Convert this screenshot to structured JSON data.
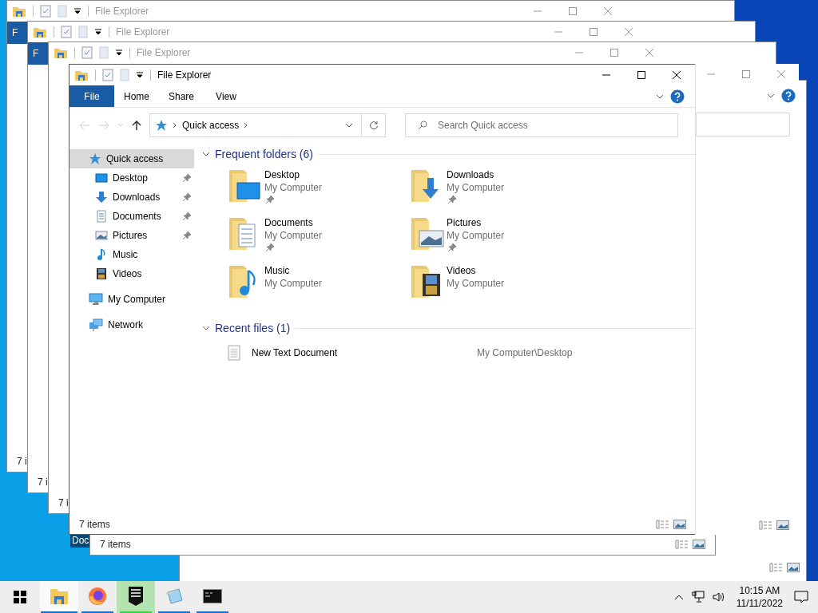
{
  "ghost_windows": [
    {
      "title": "File Explorer",
      "tab": "F",
      "status": "7 i"
    },
    {
      "title": "File Explorer",
      "tab": "F",
      "status": "7 i"
    },
    {
      "title": "File Explorer",
      "status": "7 i"
    },
    {
      "status": "7 items"
    }
  ],
  "desktop_icon": {
    "label": "Doc"
  },
  "window": {
    "title": "File Explorer",
    "ribbon_tabs": [
      {
        "label": "File",
        "selected": true
      },
      {
        "label": "Home",
        "selected": false
      },
      {
        "label": "Share",
        "selected": false
      },
      {
        "label": "View",
        "selected": false
      }
    ],
    "address": {
      "location": "Quick access"
    },
    "search": {
      "placeholder": "Search Quick access"
    },
    "sidebar": {
      "items": [
        {
          "label": "Quick access",
          "kind": "star",
          "selected": true,
          "children": [
            {
              "label": "Desktop",
              "kind": "desktop",
              "pinned": true,
              "selected": false
            },
            {
              "label": "Downloads",
              "kind": "downloads",
              "pinned": true,
              "selected": false
            },
            {
              "label": "Documents",
              "kind": "documents",
              "pinned": true,
              "selected": false
            },
            {
              "label": "Pictures",
              "kind": "pictures",
              "pinned": true,
              "selected": false
            },
            {
              "label": "Music",
              "kind": "music",
              "pinned": false,
              "selected": false
            },
            {
              "label": "Videos",
              "kind": "videos",
              "pinned": false,
              "selected": false
            }
          ]
        },
        {
          "label": "My Computer",
          "kind": "computer",
          "selected": false
        },
        {
          "label": "Network",
          "kind": "network",
          "selected": false
        }
      ]
    },
    "frequent_folders": {
      "title": "Frequent folders (6)",
      "items": [
        {
          "name": "Desktop",
          "location": "My Computer",
          "kind": "desktop",
          "pinned": true
        },
        {
          "name": "Downloads",
          "location": "My Computer",
          "kind": "downloads",
          "pinned": true
        },
        {
          "name": "Documents",
          "location": "My Computer",
          "kind": "documents",
          "pinned": true
        },
        {
          "name": "Pictures",
          "location": "My Computer",
          "kind": "pictures",
          "pinned": true
        },
        {
          "name": "Music",
          "location": "My Computer",
          "kind": "music",
          "pinned": false
        },
        {
          "name": "Videos",
          "location": "My Computer",
          "kind": "videos",
          "pinned": false
        }
      ]
    },
    "recent_files": {
      "title": "Recent files (1)",
      "items": [
        {
          "name": "New Text Document",
          "path": "My Computer\\Desktop"
        }
      ]
    },
    "status_bar": {
      "items": "7 items"
    }
  },
  "taskbar": {
    "apps": [
      {
        "kind": "explorer",
        "highlighted": false,
        "selected": true
      },
      {
        "kind": "firefox",
        "highlighted": false,
        "selected": false
      },
      {
        "kind": "epic",
        "highlighted": true,
        "selected": false
      },
      {
        "kind": "notepad",
        "highlighted": false,
        "selected": false
      },
      {
        "kind": "terminal",
        "highlighted": false,
        "selected": false
      }
    ],
    "time": "10:15 AM",
    "date": "11/11/2022"
  }
}
